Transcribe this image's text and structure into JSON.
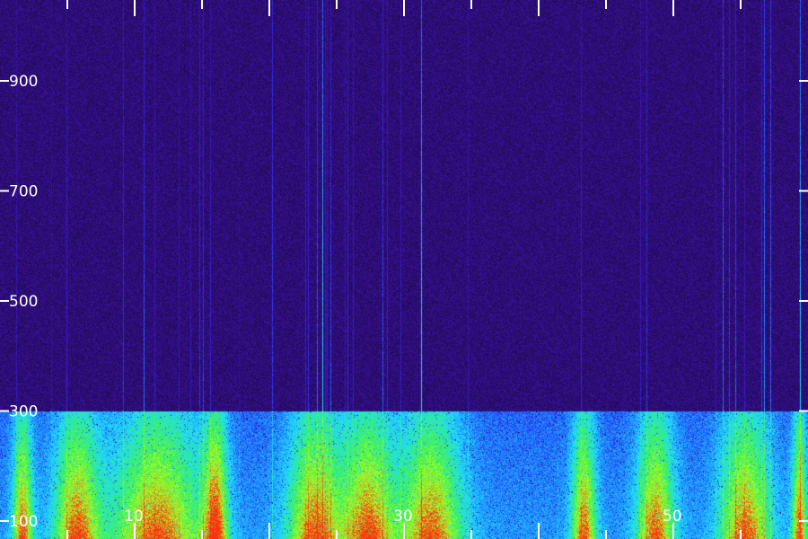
{
  "chart_data": {
    "type": "heatmap",
    "title": "",
    "xlabel": "",
    "ylabel": "",
    "y_ticks": [
      "100",
      "300",
      "500",
      "700",
      "900"
    ],
    "x_tick_labels": [
      "10",
      "30",
      "50"
    ],
    "x_ticks_unlabeled": 6,
    "colormap": [
      "#1a0a3a",
      "#3a10a0",
      "#2a2af0",
      "#1e8cff",
      "#22e0ff",
      "#36f05a",
      "#b0ff20",
      "#ff3010"
    ],
    "band_boundary": "300",
    "background_color": "#1b0c2e"
  }
}
